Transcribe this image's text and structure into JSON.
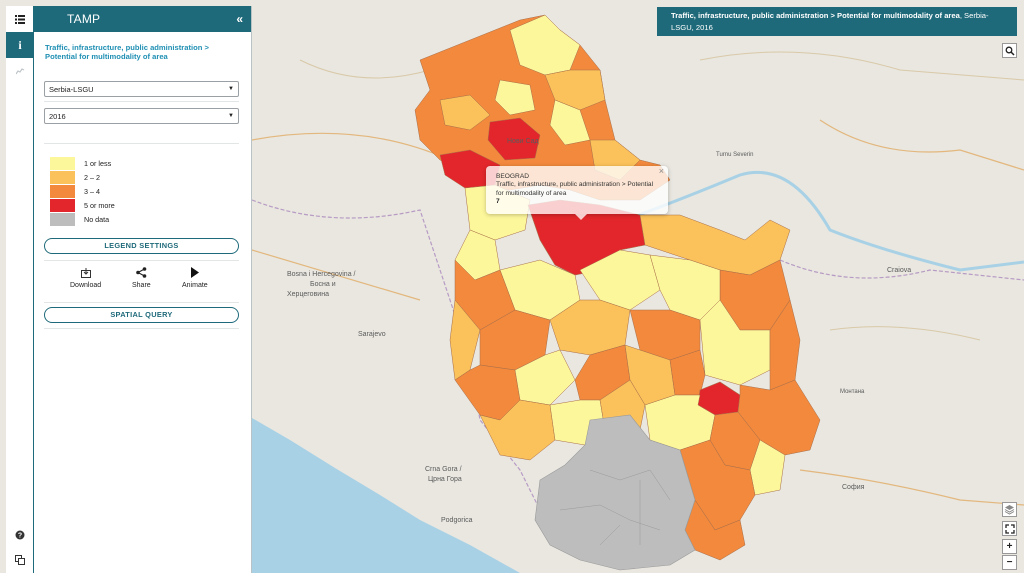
{
  "app": {
    "title": "TAMP",
    "collapse_icon": "double-chevron-left-icon"
  },
  "panel": {
    "indicator_title": "Traffic, infrastructure, public administration > Potential for multimodality of area",
    "region_select": "Serbia-LSGU",
    "year_select": "2016",
    "legend_settings_label": "LEGEND SETTINGS",
    "spatial_query_label": "SPATIAL QUERY",
    "tools": [
      {
        "label": "Download",
        "icon": "download-icon"
      },
      {
        "label": "Share",
        "icon": "share-icon"
      },
      {
        "label": "Animate",
        "icon": "play-icon"
      }
    ]
  },
  "legend": [
    {
      "label": "1 or less",
      "color": "#fdf79b"
    },
    {
      "label": "2 – 2",
      "color": "#fbc15a"
    },
    {
      "label": "3 – 4",
      "color": "#f2893c"
    },
    {
      "label": "5 or more",
      "color": "#e3262b"
    },
    {
      "label": "No data",
      "color": "#bdbdbd"
    }
  ],
  "info_bar": {
    "bold": "Traffic, infrastructure, public administration > Potential for multimodality of area",
    "rest": ", Serbia-LSGU, 2016"
  },
  "popup": {
    "name": "BEOGRAD",
    "indicator": "Traffic, infrastructure, public administration > Potential for multimodality of area",
    "value": "7"
  },
  "map_labels": {
    "novi_sad": "Нови Сад",
    "bosnia": [
      "Bosna i Hercegovina /",
      "Босна и",
      "Херцеговина"
    ],
    "sarajevo": "Sarajevo",
    "montenegro": [
      "Crna Gora /",
      "Црна Гора"
    ],
    "podgorica": "Podgorica",
    "craiova": "Craiova",
    "sofia": "София",
    "severin": "Turnu Severin",
    "montana": "Монтана"
  },
  "colors": {
    "accent": "#1f6a7a",
    "link": "#1f8fb3",
    "water": "#a8d1e6"
  }
}
